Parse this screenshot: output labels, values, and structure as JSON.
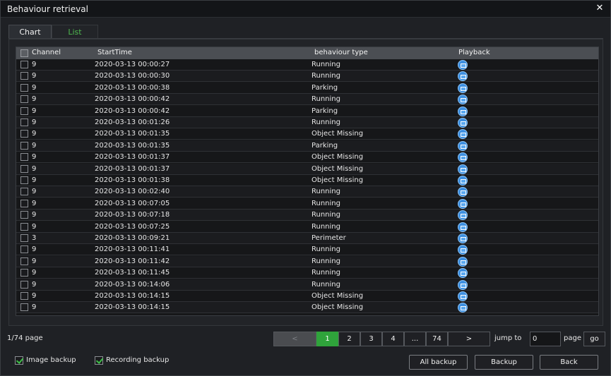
{
  "window": {
    "title": "Behaviour retrieval",
    "close_glyph": "✕"
  },
  "tabs": [
    {
      "label": "Chart",
      "active": false
    },
    {
      "label": "List",
      "active": true
    }
  ],
  "table": {
    "columns": [
      "Channel",
      "StartTime",
      "behaviour type",
      "Playback"
    ],
    "rows": [
      {
        "channel": "9",
        "start": "2020-03-13 00:00:27",
        "type": "Running"
      },
      {
        "channel": "9",
        "start": "2020-03-13 00:00:30",
        "type": "Running"
      },
      {
        "channel": "9",
        "start": "2020-03-13 00:00:38",
        "type": "Parking"
      },
      {
        "channel": "9",
        "start": "2020-03-13 00:00:42",
        "type": "Running"
      },
      {
        "channel": "9",
        "start": "2020-03-13 00:00:42",
        "type": "Parking"
      },
      {
        "channel": "9",
        "start": "2020-03-13 00:01:26",
        "type": "Running"
      },
      {
        "channel": "9",
        "start": "2020-03-13 00:01:35",
        "type": "Object Missing"
      },
      {
        "channel": "9",
        "start": "2020-03-13 00:01:35",
        "type": "Parking"
      },
      {
        "channel": "9",
        "start": "2020-03-13 00:01:37",
        "type": "Object Missing"
      },
      {
        "channel": "9",
        "start": "2020-03-13 00:01:37",
        "type": "Object Missing"
      },
      {
        "channel": "9",
        "start": "2020-03-13 00:01:38",
        "type": "Object Missing"
      },
      {
        "channel": "9",
        "start": "2020-03-13 00:02:40",
        "type": "Running"
      },
      {
        "channel": "9",
        "start": "2020-03-13 00:07:05",
        "type": "Running"
      },
      {
        "channel": "9",
        "start": "2020-03-13 00:07:18",
        "type": "Running"
      },
      {
        "channel": "9",
        "start": "2020-03-13 00:07:25",
        "type": "Running"
      },
      {
        "channel": "3",
        "start": "2020-03-13 00:09:21",
        "type": "Perimeter"
      },
      {
        "channel": "9",
        "start": "2020-03-13 00:11:41",
        "type": "Running"
      },
      {
        "channel": "9",
        "start": "2020-03-13 00:11:42",
        "type": "Running"
      },
      {
        "channel": "9",
        "start": "2020-03-13 00:11:45",
        "type": "Running"
      },
      {
        "channel": "9",
        "start": "2020-03-13 00:14:06",
        "type": "Running"
      },
      {
        "channel": "9",
        "start": "2020-03-13 00:14:15",
        "type": "Object Missing"
      },
      {
        "channel": "9",
        "start": "2020-03-13 00:14:15",
        "type": "Object Missing"
      }
    ],
    "playback_icon": "playback-icon"
  },
  "pagination": {
    "info": "1/74 page",
    "prev": "<",
    "pages": [
      "1",
      "2",
      "3",
      "4",
      "...",
      "74"
    ],
    "next": ">",
    "active_page": "1",
    "jump_label": "jump to",
    "jump_value": "0",
    "page_label": "page",
    "go_label": "go"
  },
  "options": {
    "image_backup": {
      "label": "Image backup",
      "checked": true
    },
    "recording_backup": {
      "label": "Recording backup",
      "checked": true
    }
  },
  "buttons": {
    "all_backup": "All backup",
    "backup": "Backup",
    "back": "Back"
  },
  "colors": {
    "accent_green": "#2fa33b",
    "tab_active_text": "#4fb84f",
    "playback_blue": "#3d8fe0"
  }
}
